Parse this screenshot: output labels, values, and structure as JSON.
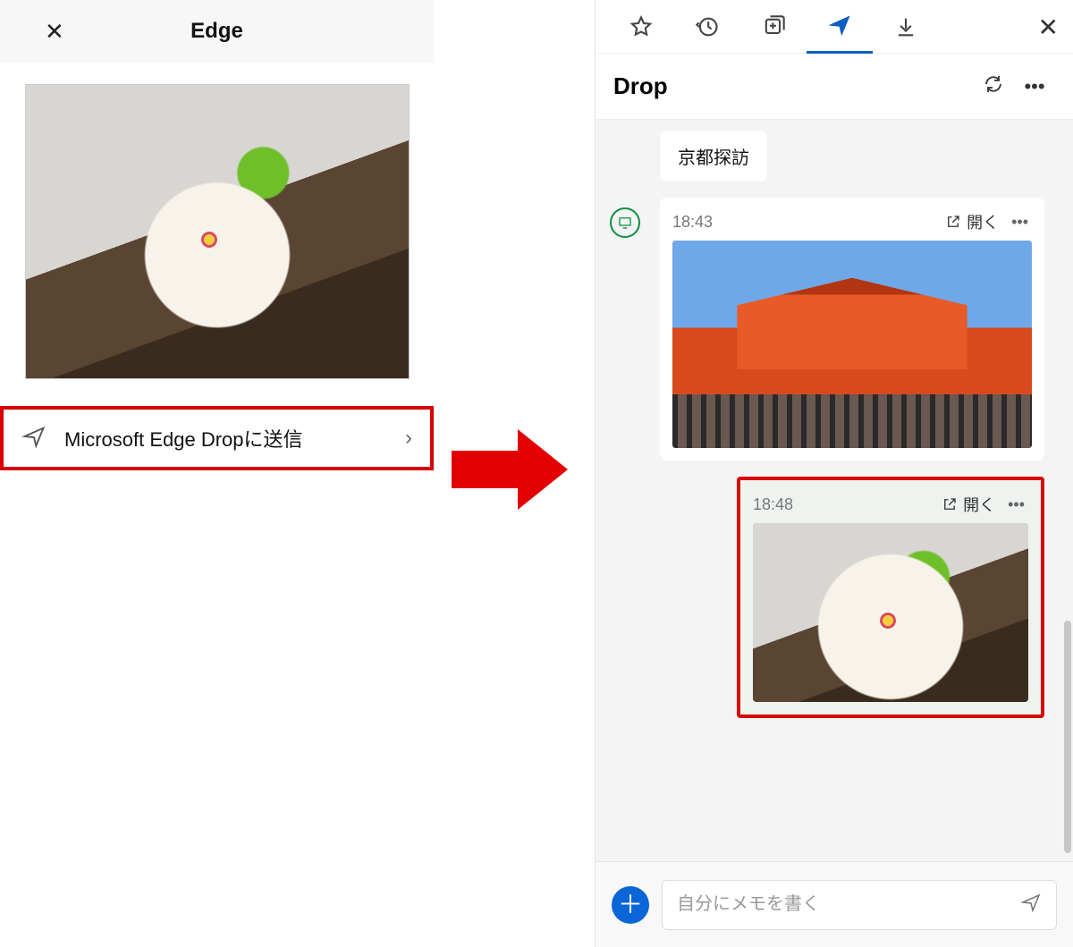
{
  "left": {
    "title": "Edge",
    "share_label": "Microsoft Edge Dropに送信"
  },
  "right": {
    "panel_title": "Drop",
    "text_message": "京都探訪",
    "cards": [
      {
        "time": "18:43",
        "open_label": "開く"
      },
      {
        "time": "18:48",
        "open_label": "開く"
      }
    ],
    "composer_placeholder": "自分にメモを書く"
  }
}
